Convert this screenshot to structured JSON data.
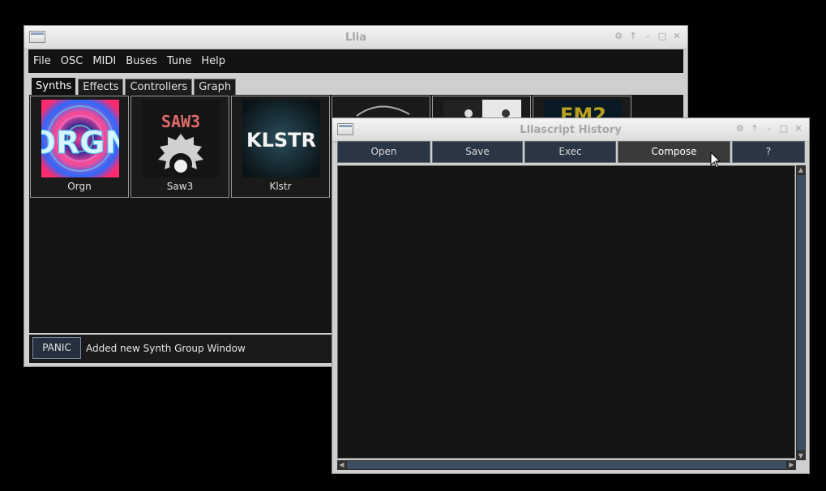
{
  "main_window": {
    "title": "Llia",
    "menu": [
      "File",
      "OSC",
      "MIDI",
      "Buses",
      "Tune",
      "Help"
    ],
    "tabs": [
      "Synths",
      "Effects",
      "Controllers",
      "Graph"
    ],
    "active_tab": "Synths",
    "synths": [
      {
        "label": "Orgn",
        "art_text": "ORGN"
      },
      {
        "label": "Saw3",
        "art_text": "SAW3"
      },
      {
        "label": "Klstr",
        "art_text": "KLSTR"
      }
    ],
    "partial_tile_text": "FM2",
    "panic_label": "PANIC",
    "status_message": "Added new Synth Group Window"
  },
  "history_window": {
    "title": "Lliascript History",
    "buttons": [
      "Open",
      "Save",
      "Exec",
      "Compose",
      "?"
    ],
    "hovered_button": "Compose",
    "content": ""
  },
  "colors": {
    "button_bg": "#2a3644",
    "pane_bg": "#151515",
    "chrome": "#cfcfcf",
    "scroll_thumb": "#3c4e62"
  }
}
